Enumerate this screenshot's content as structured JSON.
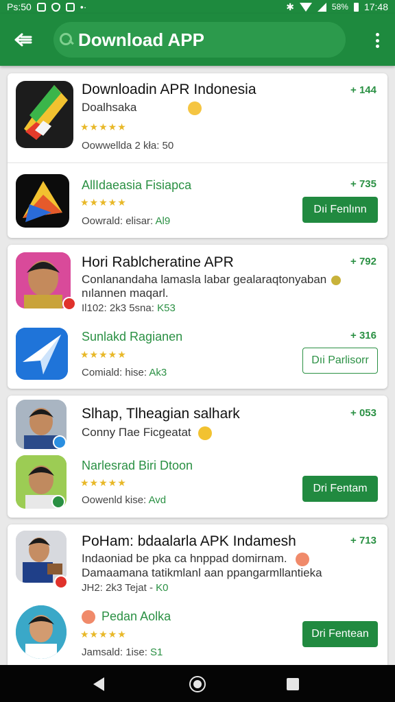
{
  "status_bar": {
    "left_text": "Ps:50",
    "battery": "58%",
    "time": "17:48"
  },
  "app_bar": {
    "back_icon": "arrow-left-icon",
    "search_text": "Download APP",
    "menu_icon": "more-vert-icon"
  },
  "cards": [
    {
      "rows": [
        {
          "title": "Downloadin APR Indonesia",
          "title_style": "black",
          "desc": "Doalhsaka",
          "desc2": "",
          "stars": "★★★★★",
          "meta": "Oowwelldа 2 kłа: 50",
          "meta_value": "",
          "count": "+ 144",
          "button": ""
        },
        {
          "title": "AllIdaeasia Fisiapca",
          "title_style": "green",
          "desc": "",
          "desc2": "",
          "stars": "★★★★★",
          "meta": "Oowrald: elisar:",
          "meta_value": "Al9",
          "count": "+ 735",
          "button": "Dıi Fenlınn",
          "button_style": "filled"
        }
      ]
    },
    {
      "rows": [
        {
          "title": "Hori Rablcheratine APR",
          "title_style": "black",
          "desc": "Conlanandaha lamasla labar gealaraqtonyaban",
          "desc2": "nılannen maqarl.",
          "stars": "",
          "meta": "Il102: 2k3 5sna:",
          "meta_value": "K53",
          "count": "+ 792",
          "button": ""
        },
        {
          "title": "Sunlakd Ragianen",
          "title_style": "green",
          "desc": "",
          "desc2": "",
          "stars": "★★★★★",
          "meta": "Comiald: hise:",
          "meta_value": "Ak3",
          "count": "+ 316",
          "button": "Dıi Parlisorr",
          "button_style": "outline"
        }
      ]
    },
    {
      "rows": [
        {
          "title": "Slhap, Tlheagian salhark",
          "title_style": "black",
          "desc": "Conny Пае Ficgeatat",
          "desc2": "",
          "stars": "",
          "meta": "",
          "meta_value": "",
          "count": "+ 053",
          "button": ""
        },
        {
          "title": "Narlesrad Biri Dtoon",
          "title_style": "green",
          "desc": "",
          "desc2": "",
          "stars": "★★★★★",
          "meta": "Oowenld kise:",
          "meta_value": "Avd",
          "count": "",
          "button": "Dri Fentam",
          "button_style": "filled"
        }
      ]
    },
    {
      "rows": [
        {
          "title": "PoHam: bdaalarla APK Indamesh",
          "title_style": "black",
          "desc": "Indaoniad be pka ca hnppad domirnam.",
          "desc2": "Damaamana tatikmlanl aan ppangarmllantieka",
          "stars": "",
          "meta": "JH2: 2k3 Tejat -",
          "meta_value": "K0",
          "count": "+ 713",
          "button": ""
        },
        {
          "title": "Pedan Aolka",
          "title_style": "green",
          "desc": "",
          "desc2": "",
          "stars": "★★★★★",
          "meta": "Jamsald: 1ise:",
          "meta_value": "S1",
          "count": "",
          "button": "Dri Fentean",
          "button_style": "filled"
        }
      ]
    }
  ],
  "nav_bar": {
    "back_icon": "nav-back-icon",
    "home_icon": "nav-home-icon",
    "recents_icon": "nav-recents-icon"
  }
}
